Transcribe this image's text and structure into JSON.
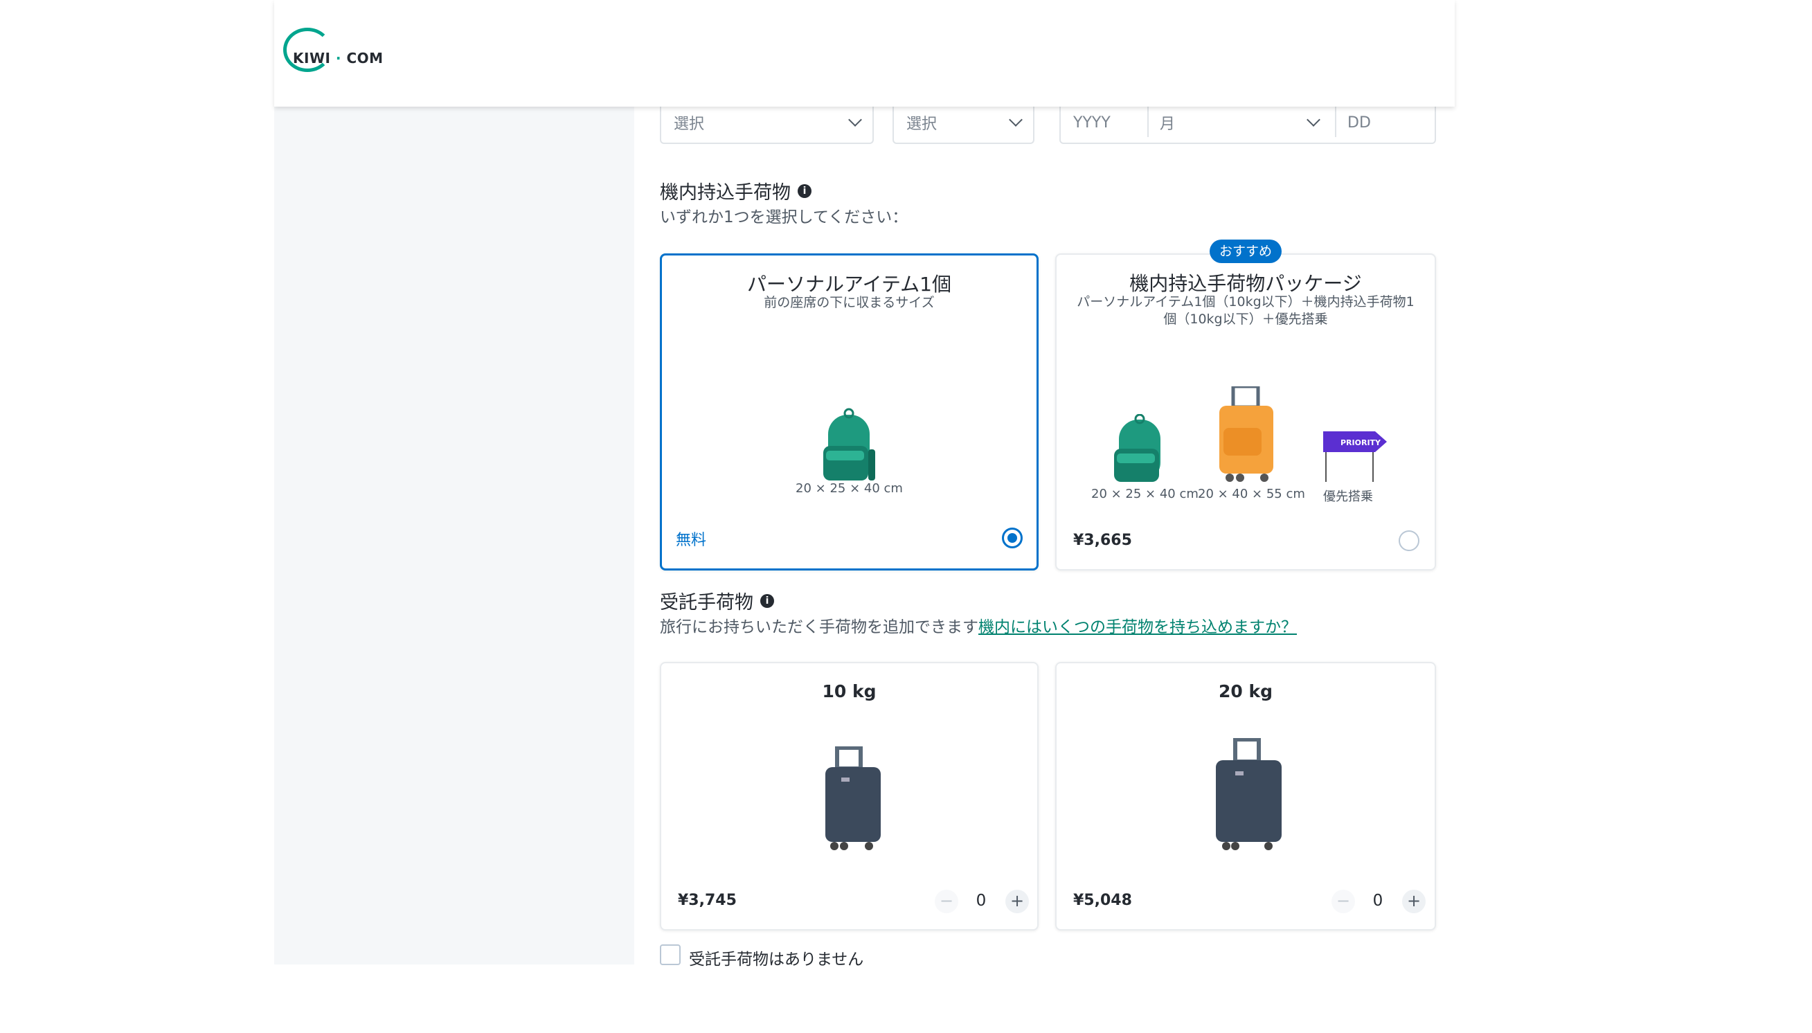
{
  "brand": {
    "logo_text": "KIWI",
    "logo_dot": "·",
    "logo_suffix": "COM",
    "color": "#00a58e"
  },
  "form": {
    "select1": "選択",
    "select2": "選択",
    "year": "YYYY",
    "month": "月",
    "day": "DD"
  },
  "cabin": {
    "title": "機内持込手荷物",
    "subtitle": "いずれか1つを選択してください：",
    "options": [
      {
        "title": "パーソナルアイテム1個",
        "desc": "前の座席の下に収まるサイズ",
        "dims": [
          "20 × 25 × 40 cm"
        ],
        "price": "無料",
        "selected": true
      },
      {
        "badge": "おすすめ",
        "title": "機内持込手荷物パッケージ",
        "desc": "パーソナルアイテム1個（10kg以下）＋機内持込手荷物1個（10kg以下）＋優先搭乗",
        "dims": [
          "20 × 25 × 40 cm",
          "20 × 40 × 55 cm",
          "優先搭乗"
        ],
        "priority_sign": "PRIORITY",
        "price": "¥3,665",
        "selected": false
      }
    ]
  },
  "checked": {
    "title": "受託手荷物",
    "subtitle": "旅行にお持ちいただく手荷物を追加できます",
    "link": "機内にはいくつの手荷物を持ち込めますか？",
    "options": [
      {
        "weight": "10 kg",
        "price": "¥3,745",
        "qty": "0"
      },
      {
        "weight": "20 kg",
        "price": "¥5,048",
        "qty": "0"
      }
    ],
    "none_label": "受託手荷物はありません"
  },
  "colors": {
    "accent": "#0172cb",
    "link": "#00826f"
  }
}
